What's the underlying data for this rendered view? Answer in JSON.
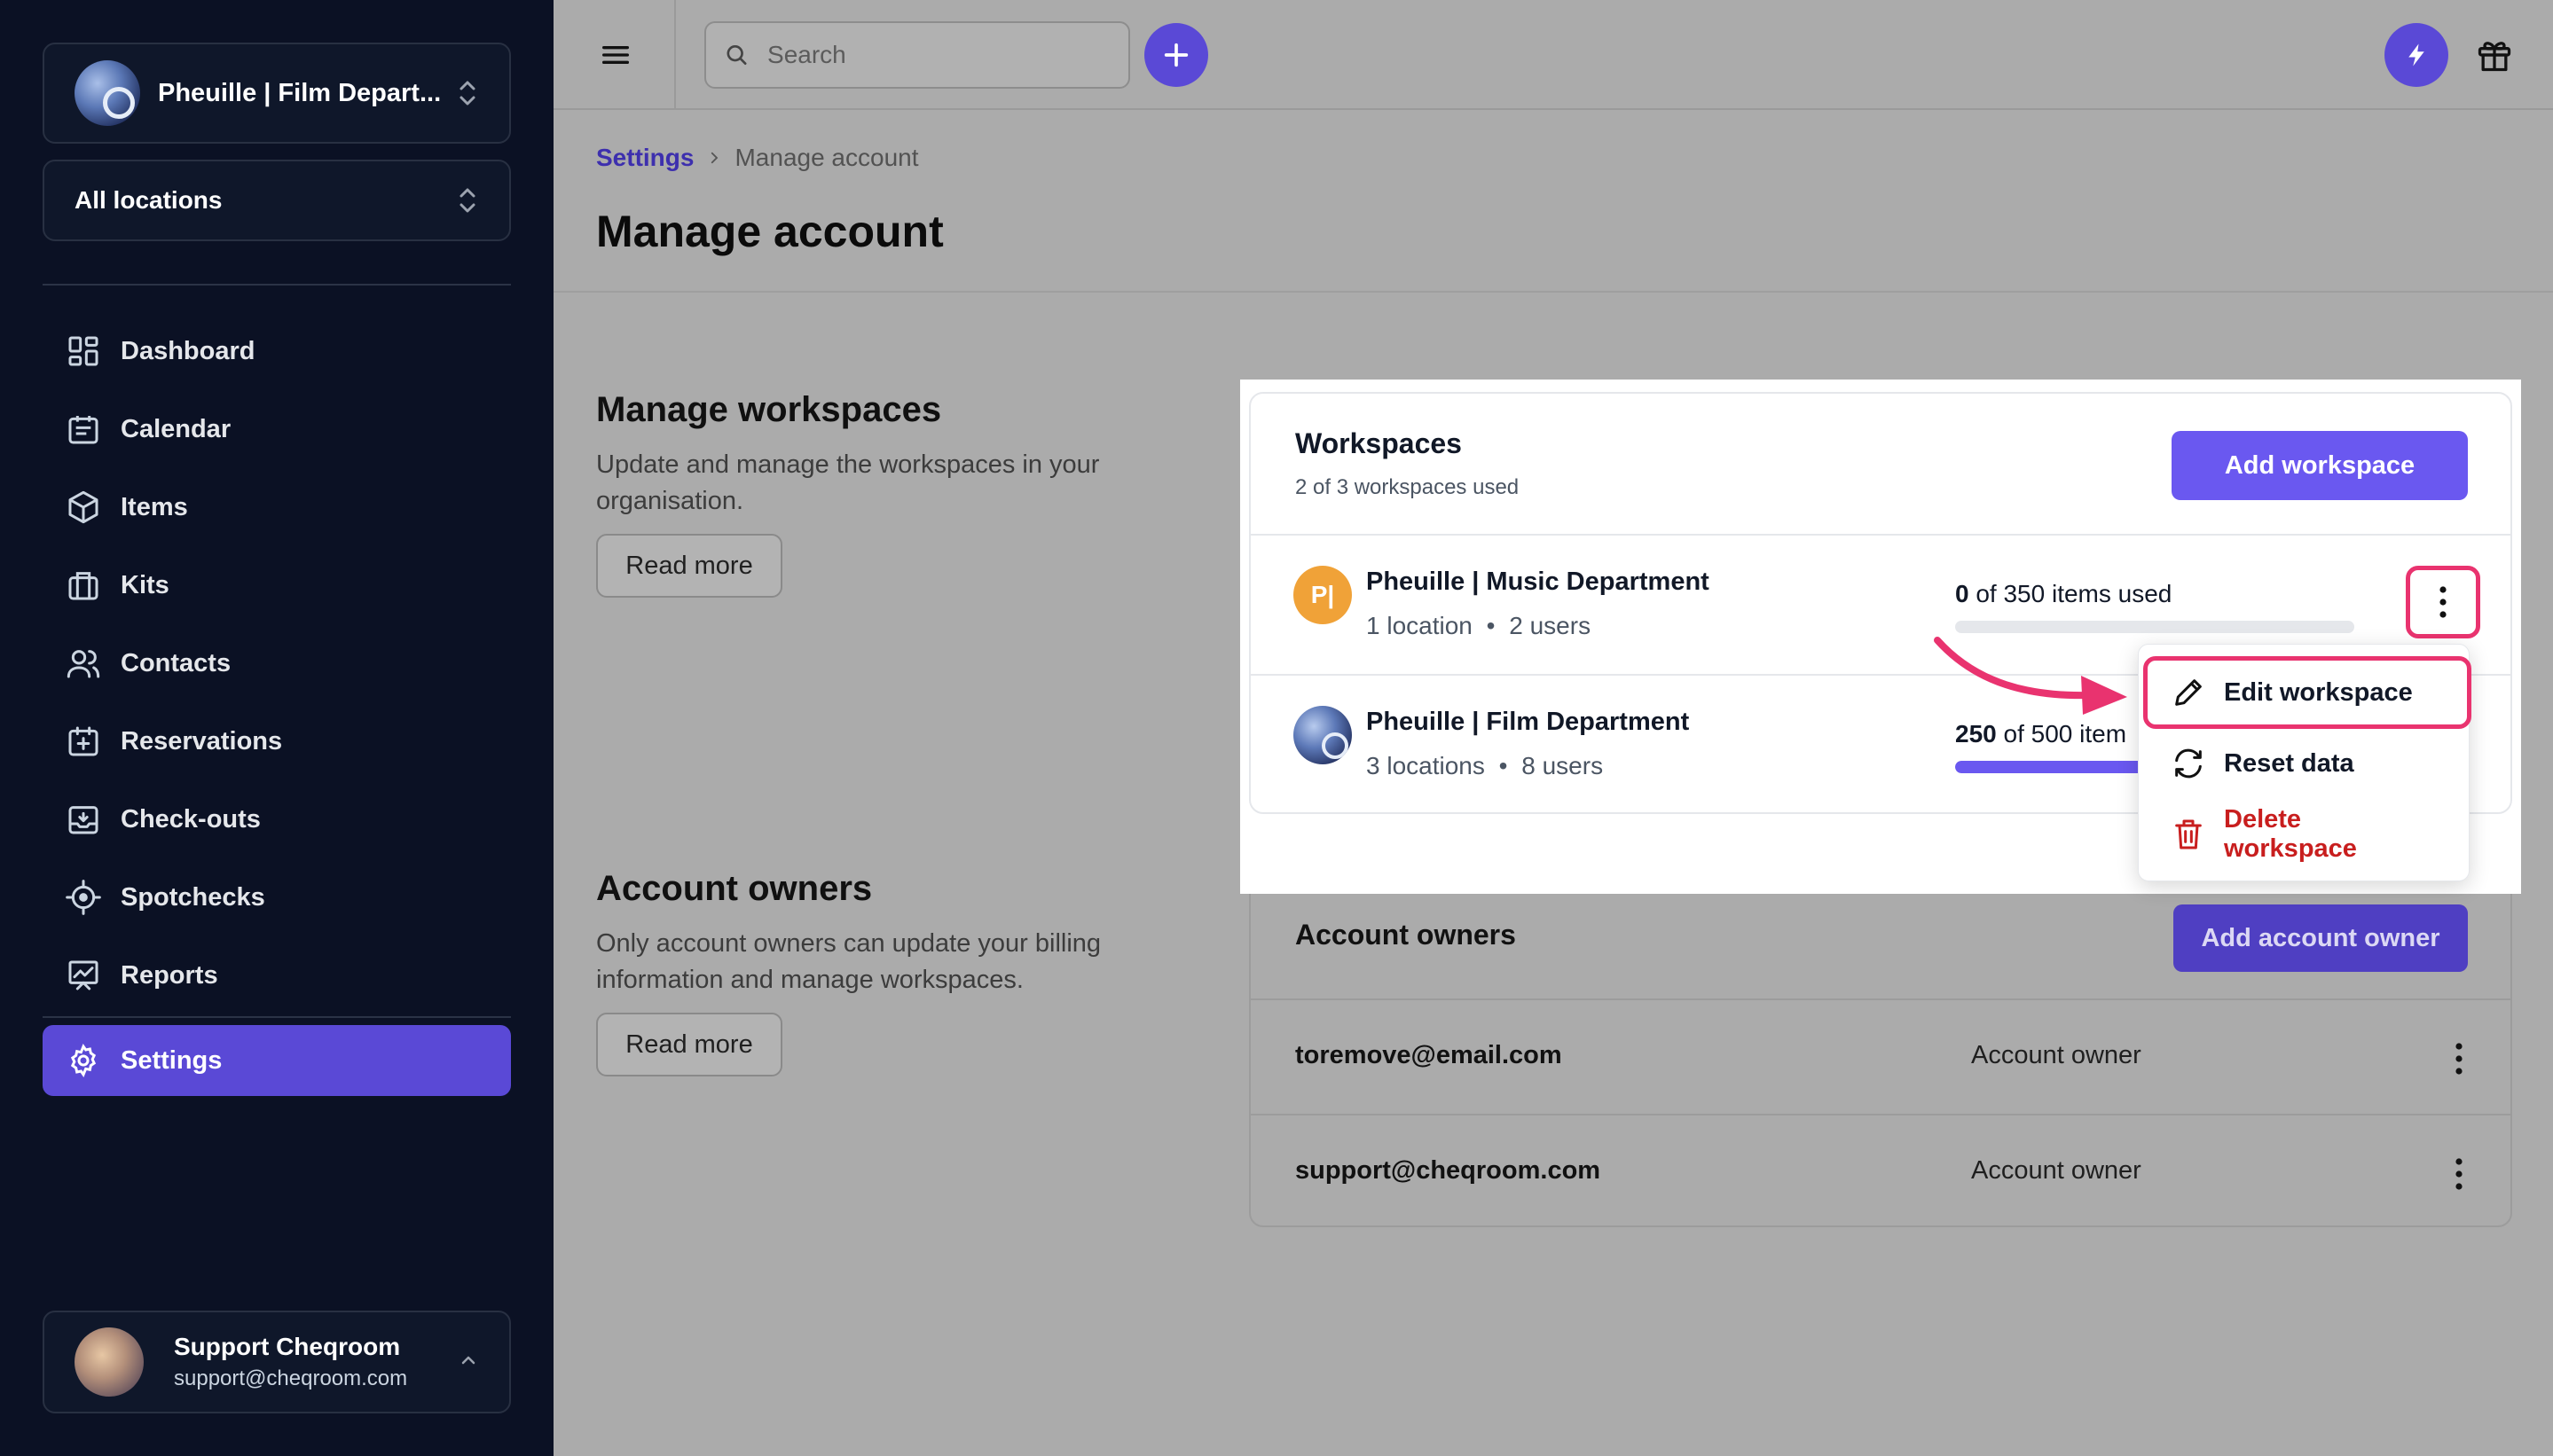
{
  "sidebar": {
    "workspace_name": "Pheuille | Film Depart...",
    "location": "All locations",
    "nav": [
      {
        "label": "Dashboard",
        "icon": "dashboard-icon"
      },
      {
        "label": "Calendar",
        "icon": "calendar-icon"
      },
      {
        "label": "Items",
        "icon": "cube-icon"
      },
      {
        "label": "Kits",
        "icon": "briefcase-icon"
      },
      {
        "label": "Contacts",
        "icon": "users-icon"
      },
      {
        "label": "Reservations",
        "icon": "calendar-plus-icon"
      },
      {
        "label": "Check-outs",
        "icon": "inbox-down-icon"
      },
      {
        "label": "Spotchecks",
        "icon": "crosshair-icon"
      },
      {
        "label": "Reports",
        "icon": "presentation-chart-icon"
      }
    ],
    "settings_label": "Settings",
    "user": {
      "name": "Support Cheqroom",
      "email": "support@cheqroom.com"
    }
  },
  "topbar": {
    "search_placeholder": "Search"
  },
  "breadcrumb": {
    "parent": "Settings",
    "current": "Manage account"
  },
  "page_title": "Manage account",
  "manage_workspaces": {
    "title": "Manage workspaces",
    "description": "Update and manage the workspaces in your organisation.",
    "read_more": "Read more"
  },
  "account_owners_section": {
    "title": "Account owners",
    "description": "Only account owners can update your billing information and manage workspaces.",
    "read_more": "Read more"
  },
  "workspaces_card": {
    "title": "Workspaces",
    "subtitle": "2 of 3 workspaces used",
    "add_button": "Add workspace",
    "rows": [
      {
        "avatar_letters": "P|",
        "name": "Pheuille | Music Department",
        "locations": "1 location",
        "users": "2 users",
        "used": "0",
        "usage_rest": " of 350 items used",
        "progress": 0.0
      },
      {
        "avatar_letters": "",
        "name": "Pheuille | Film Department",
        "locations": "3 locations",
        "users": "8 users",
        "used": "250",
        "usage_rest": " of 500 item",
        "progress": 0.5
      }
    ]
  },
  "menu": {
    "edit": "Edit workspace",
    "reset": "Reset data",
    "delete": "Delete workspace"
  },
  "owners_card": {
    "title": "Account owners",
    "add_button": "Add account owner",
    "rows": [
      {
        "email": "toremove@email.com",
        "role": "Account owner"
      },
      {
        "email": "support@cheqroom.com",
        "role": "Account owner"
      }
    ]
  },
  "colors": {
    "accent": "#6a58f0",
    "highlight": "#e9336f",
    "sidebar": "#0b1124",
    "danger": "#c81e1e"
  }
}
